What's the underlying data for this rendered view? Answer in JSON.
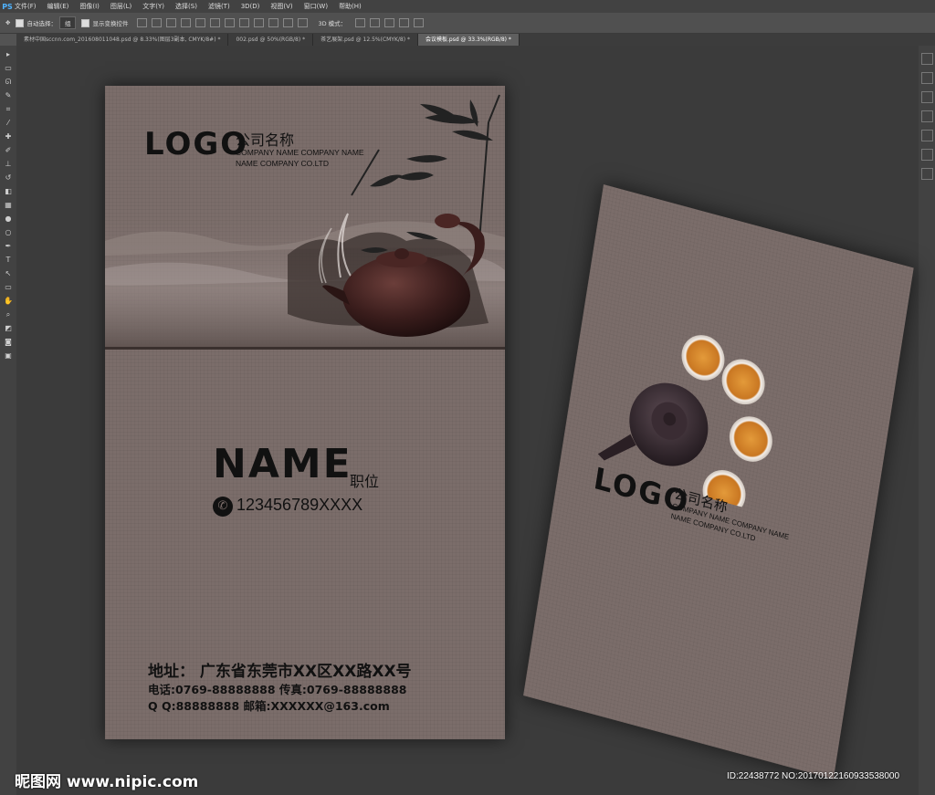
{
  "menubar": {
    "app_icon": "PS",
    "items": [
      "文件(F)",
      "编辑(E)",
      "图像(I)",
      "图层(L)",
      "文字(Y)",
      "选择(S)",
      "滤镜(T)",
      "3D(D)",
      "视图(V)",
      "窗口(W)",
      "帮助(H)"
    ]
  },
  "options": {
    "auto_select": "自动选择：",
    "auto_select_value": "组",
    "show_transform": "显示变换控件",
    "mode_3d": "3D 模式："
  },
  "tabs": [
    "素材中国sccnn.com_201608011048.psd @ 8.33%(图层3副本, CMYK/8#) *",
    "002.psd @ 50%(RGB/8) *",
    "茶艺展架.psd @ 12.5%(CMYK/8) *",
    "会议模板.psd @ 33.3%(RGB/8) *"
  ],
  "front_card": {
    "logo": "LOGO",
    "company_cn": "公司名称",
    "company_en_1": "COMPANY NAME COMPANY NAME",
    "company_en_2": "NAME COMPANY CO.LTD",
    "name": "NAME",
    "position": "职位",
    "phone": "123456789XXXX",
    "address": "地址：  广东省东莞市XX区XX路XX号",
    "tel_fax": "电话:0769-88888888  传真:0769-88888888",
    "qq_email": "Q Q:88888888  邮箱:XXXXXX@163.com"
  },
  "back_card": {
    "logo": "LOGO",
    "company_cn": "公司名称",
    "company_en_1": "COMPANY NAME COMPANY NAME",
    "company_en_2": "NAME COMPANY CO.LTD"
  },
  "watermark": {
    "left": "昵图网 www.nipic.com",
    "right": "ID:22438772 NO:20170122160933538000"
  },
  "colors": {
    "card": "#7b6d6a",
    "ink": "#111111",
    "tea": "#d98a2b"
  }
}
